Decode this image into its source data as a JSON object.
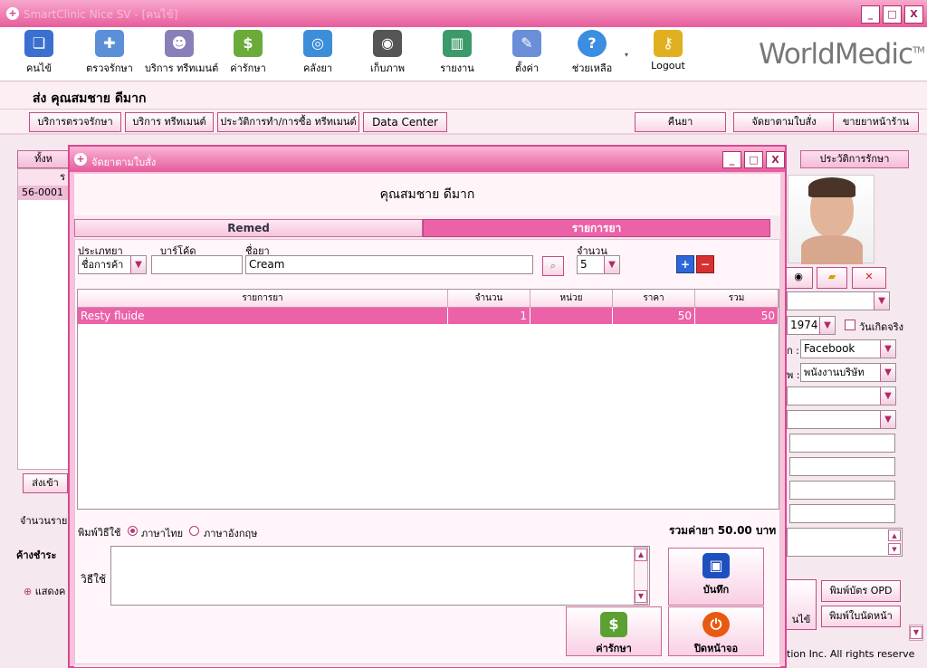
{
  "window": {
    "title": "SmartClinic Nice SV - [คนไข้]",
    "btn_min": "_",
    "btn_max": "□",
    "btn_close": "X"
  },
  "toolbar": {
    "items": [
      {
        "label": "คนไข้",
        "color": "#3b6fd0",
        "glyph": "❏"
      },
      {
        "label": "ตรวจรักษา",
        "color": "#5b8fd8",
        "glyph": "✚"
      },
      {
        "label": "บริการ ทรีทเมนต์",
        "color": "#8a7fb8",
        "glyph": "☻"
      },
      {
        "label": "ค่ารักษา",
        "color": "#6aab3a",
        "glyph": "$"
      },
      {
        "label": "คลังยา",
        "color": "#3d8ed8",
        "glyph": "◎"
      },
      {
        "label": "เก็บภาพ",
        "color": "#555555",
        "glyph": "◉"
      },
      {
        "label": "รายงาน",
        "color": "#3a9a6a",
        "glyph": "▥"
      },
      {
        "label": "ตั้งค่า",
        "color": "#6a8fd8",
        "glyph": "✎"
      },
      {
        "label": "ช่วยเหลือ",
        "color": "#3b8ee0",
        "glyph": "?"
      },
      {
        "label": "Logout",
        "color": "#e0b020",
        "glyph": "⚷"
      }
    ],
    "logo": "WorldMedic",
    "logo_mark": "TM"
  },
  "header": {
    "title": "ส่ง  คุณสมชาย ดีมาก"
  },
  "buttons": [
    "บริการตรวจรักษา",
    "บริการ ทรีทเมนต์",
    "ประวัติการทำ/การซื้อ ทรีทเมนต์",
    "Data Center",
    "คืนยา",
    "จัดยาตามใบสั่ง",
    "ขายยาหน้าร้าน"
  ],
  "background": {
    "tab_left": "ทั้งห",
    "left_header": "ร",
    "left_row": "56-0001",
    "send_btn": "ส่งเข้า",
    "count_label": "จำนวนราย",
    "outstanding": "ค้างชำระ",
    "show_label": "แสดงค",
    "tab_history": "ประวัติการรักษา",
    "birth_year": "1974",
    "real_birth": "วันเกิดจริง",
    "source_label": "ก :",
    "source_value": "Facebook",
    "job_label": "พ :",
    "job_value": "พนังงานบริษัท",
    "print_opd": "พิมพ์บัตร OPD",
    "print_appt": "พิมพ์ใบนัดหน้า",
    "patient_btn": "นไข้",
    "copyright": "tion Inc. All rights reserve"
  },
  "dialog": {
    "title": "จัดยาตามใบสั่ง",
    "patient": "คุณสมชาย    ดีมาก",
    "tab_remed": "Remed",
    "tab_items": "รายการยา",
    "label_type": "ประเภทยา",
    "label_barcode": "บาร์โค้ด",
    "label_name": "ชื่อยา",
    "label_qty": "จำนวน",
    "type_value": "ชื่อการค้า",
    "barcode_value": "",
    "name_value": "Cream",
    "qty_value": "5",
    "columns": [
      "รายการยา",
      "จำนวน",
      "หน่วย",
      "ราคา",
      "รวม"
    ],
    "rows": [
      {
        "name": "Resty fluide",
        "qty": "1",
        "unit": "",
        "price": "50",
        "total": "50"
      }
    ],
    "print_label": "พิมพ์วิธีใช้",
    "lang_th": "ภาษาไทย",
    "lang_en": "ภาษาอังกฤษ",
    "total_text": "รวมค่ายา 50.00 บาท",
    "usage_label": "วิธีใช้",
    "usage_value": "",
    "btn_save": "บันทึก",
    "btn_fee": "ค่ารักษา",
    "btn_close": "ปิดหน้าจอ"
  }
}
